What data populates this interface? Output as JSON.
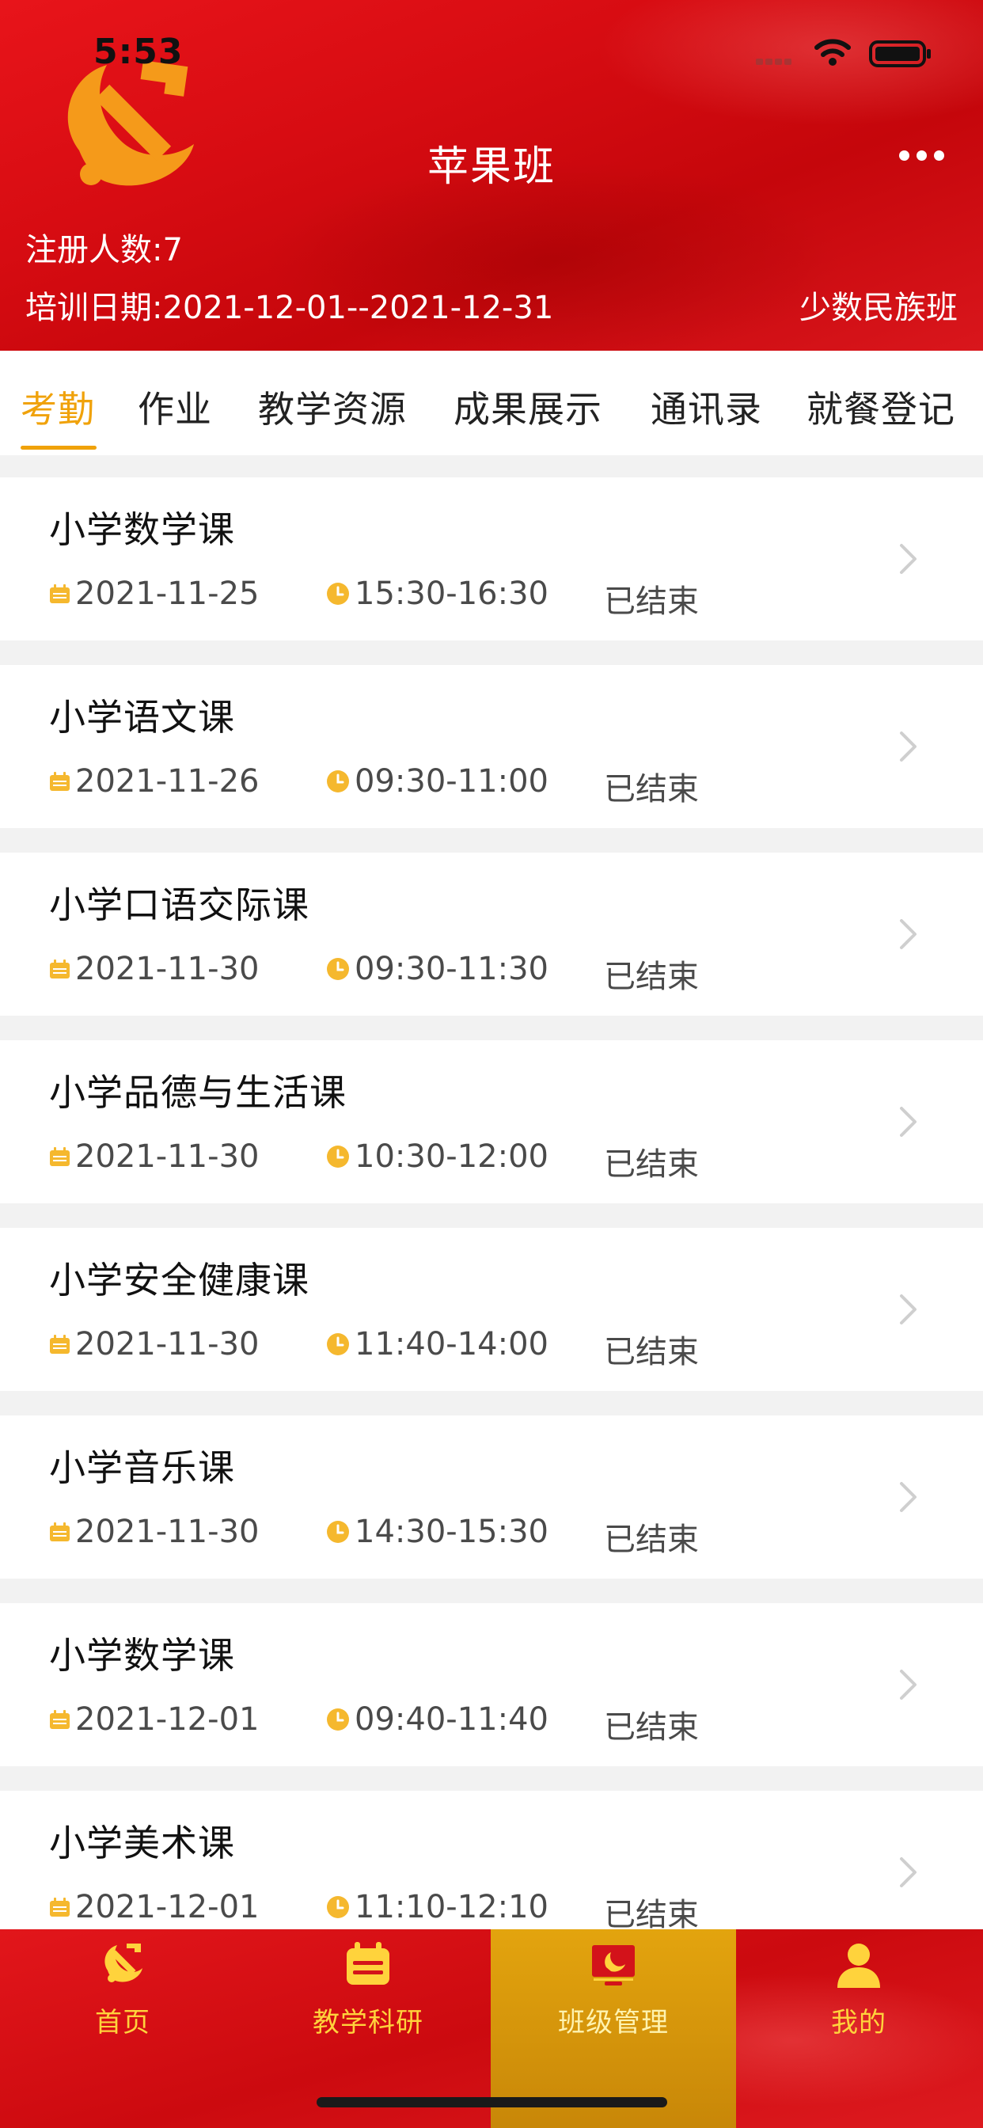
{
  "status_bar": {
    "time": "5:53"
  },
  "header": {
    "title": "苹果班",
    "registered": "注册人数:7",
    "training_date": "培训日期:2021-12-01--2021-12-31",
    "class_type": "少数民族班"
  },
  "tabs": [
    "考勤",
    "作业",
    "教学资源",
    "成果展示",
    "通讯录",
    "就餐登记"
  ],
  "active_tab": "考勤",
  "courses": [
    {
      "name": "小学数学课",
      "date": "2021-11-25",
      "time": "15:30-16:30",
      "status": "已结束"
    },
    {
      "name": "小学语文课",
      "date": "2021-11-26",
      "time": "09:30-11:00",
      "status": "已结束"
    },
    {
      "name": "小学口语交际课",
      "date": "2021-11-30",
      "time": "09:30-11:30",
      "status": "已结束"
    },
    {
      "name": "小学品德与生活课",
      "date": "2021-11-30",
      "time": "10:30-12:00",
      "status": "已结束"
    },
    {
      "name": "小学安全健康课",
      "date": "2021-11-30",
      "time": "11:40-14:00",
      "status": "已结束"
    },
    {
      "name": "小学音乐课",
      "date": "2021-11-30",
      "time": "14:30-15:30",
      "status": "已结束"
    },
    {
      "name": "小学数学课",
      "date": "2021-12-01",
      "time": "09:40-11:40",
      "status": "已结束"
    },
    {
      "name": "小学美术课",
      "date": "2021-12-01",
      "time": "11:10-12:10",
      "status": "已结束"
    }
  ],
  "bottom_nav": [
    {
      "label": "首页",
      "icon": "party-emblem-icon"
    },
    {
      "label": "教学科研",
      "icon": "calendar-icon"
    },
    {
      "label": "班级管理",
      "icon": "class-board-icon"
    },
    {
      "label": "我的",
      "icon": "user-icon"
    }
  ],
  "active_nav": "班级管理",
  "colors": {
    "brand_red": "#d70c12",
    "accent_gold": "#f0a20a",
    "nav_label": "#ffd33c"
  }
}
